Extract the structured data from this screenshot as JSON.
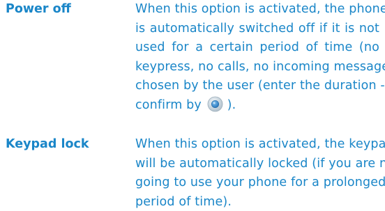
{
  "entries": [
    {
      "term": "Power off",
      "lines": [
        "When this option is activated, the phone",
        "is automatically switched off if it is not",
        "used for a certain period of time (no",
        "keypress, no calls, no incoming message)",
        "chosen by the user (enter the duration -"
      ],
      "confirm_text": "confirm by",
      "confirm_icon": "navigation-key-icon",
      "after_icon": ")."
    },
    {
      "term": "Keypad lock",
      "lines": [
        "When this option is activated, the keypad",
        "will be automatically locked (if you are not",
        "going to use your phone for a prolonged",
        "period of time)."
      ]
    }
  ],
  "colors": {
    "text": "#1a86c8",
    "icon_outer": "#c9d6df",
    "icon_inner": "#3b8fd6",
    "background": "#ffffff"
  }
}
